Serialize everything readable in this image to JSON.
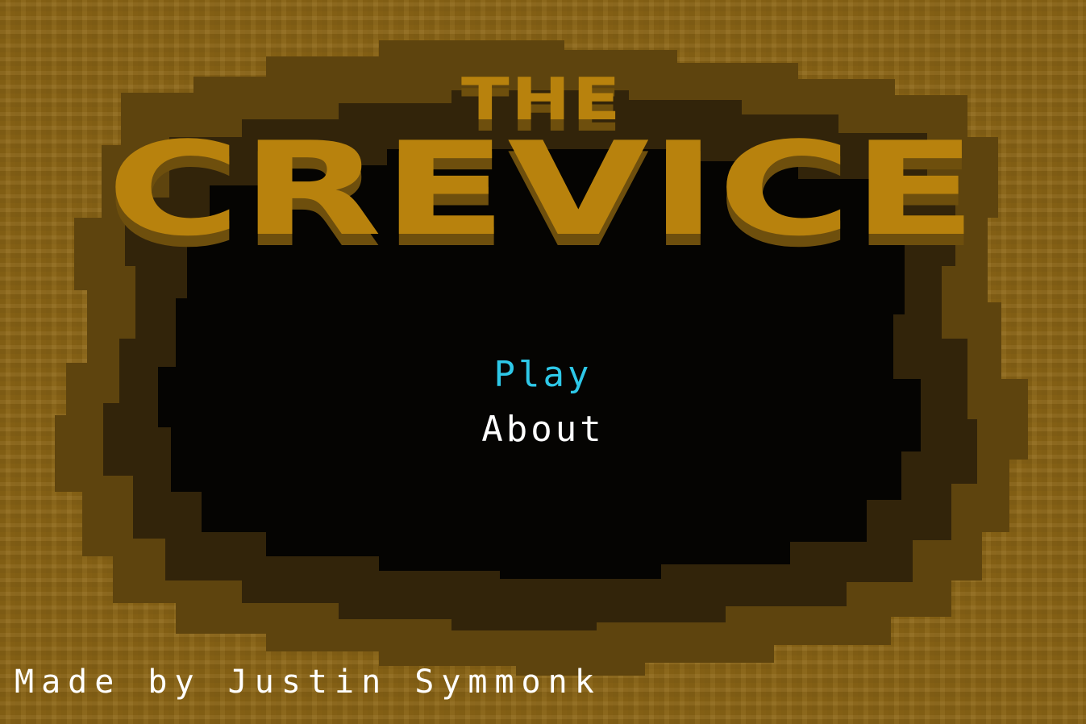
{
  "title": {
    "line1": "THE",
    "line2": "CREVICE",
    "fill_color": "#b8820c",
    "shadow_color": "#6e4f0c"
  },
  "menu": {
    "items": [
      {
        "label": "Play",
        "selected": true
      },
      {
        "label": "About",
        "selected": false
      }
    ],
    "selected_color": "#2ec8e8",
    "normal_color": "#ffffff"
  },
  "credit": {
    "text": "Made by Justin Symmonk",
    "color": "#ffffff"
  },
  "colors": {
    "dirt": "#8c6616",
    "dirt_dark": "#5e440e",
    "dirt_darker": "#32240a",
    "void": "#050402"
  }
}
